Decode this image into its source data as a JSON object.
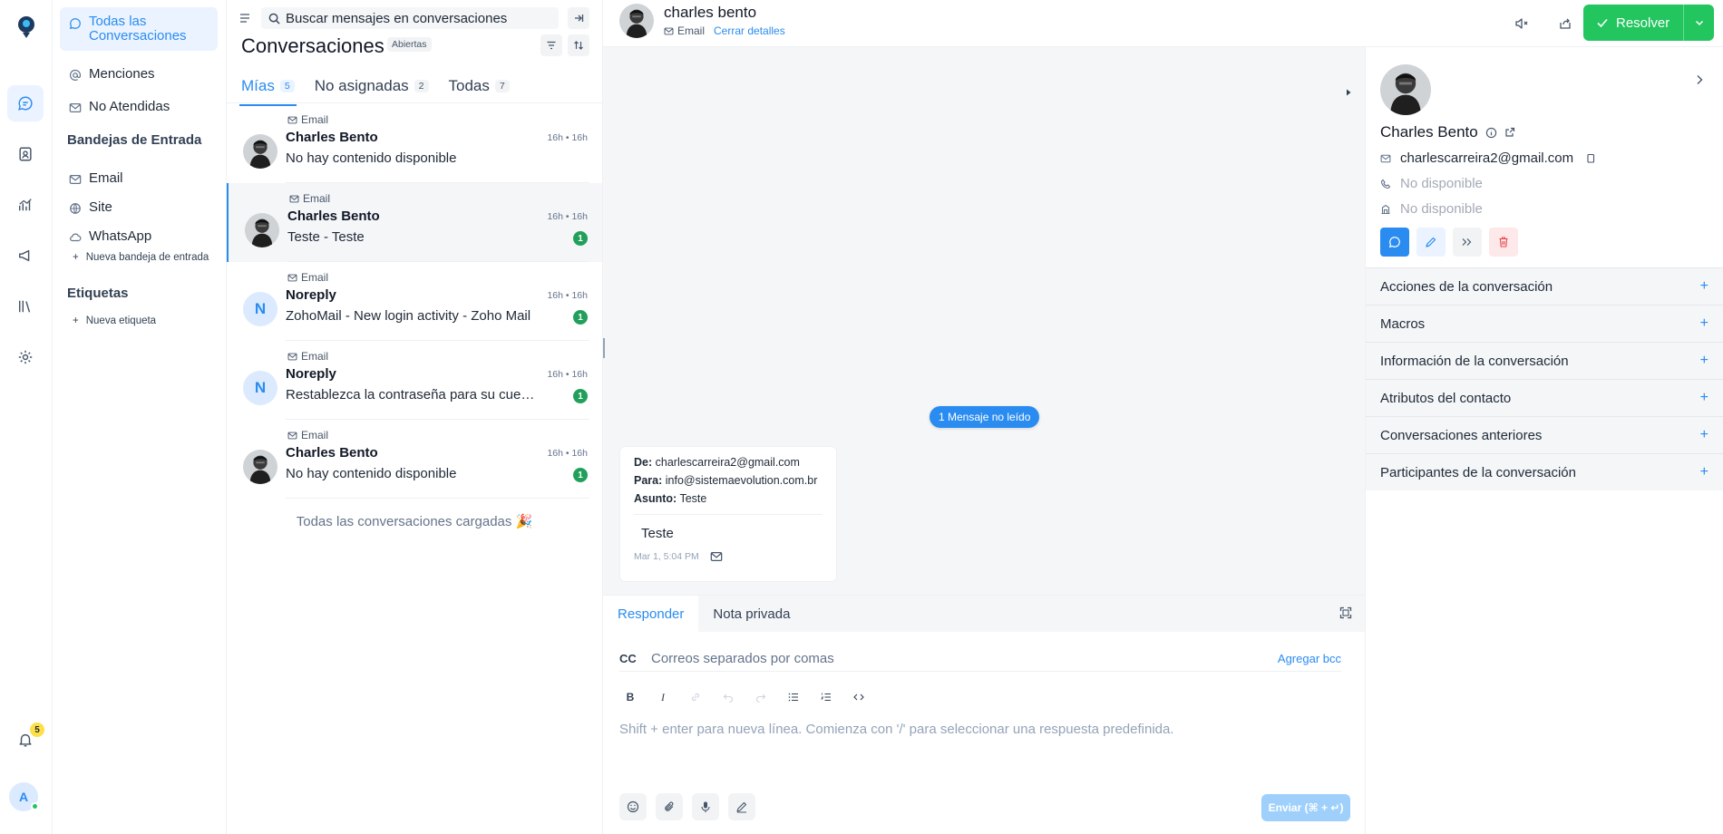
{
  "rail": {
    "notification_count": "5",
    "avatar_initial": "A"
  },
  "sidebar": {
    "items": [
      {
        "label": "Todas las Conversaciones"
      },
      {
        "label": "Menciones"
      },
      {
        "label": "No Atendidas"
      }
    ],
    "inboxes_title": "Bandejas de Entrada",
    "inboxes": [
      {
        "label": "Email"
      },
      {
        "label": "Site"
      },
      {
        "label": "WhatsApp"
      }
    ],
    "new_inbox": "Nueva bandeja de entrada",
    "labels_title": "Etiquetas",
    "new_label": "Nueva etiqueta"
  },
  "list": {
    "search_placeholder": "Buscar mensajes en conversaciones",
    "title": "Conversaciones",
    "status": "Abiertas",
    "tabs": [
      {
        "label": "Mías",
        "count": "5"
      },
      {
        "label": "No asignadas",
        "count": "2"
      },
      {
        "label": "Todas",
        "count": "7"
      }
    ],
    "conversations": [
      {
        "inbox": "Email",
        "name": "Charles Bento",
        "message": "No hay contenido disponible",
        "time": "16h • 16h",
        "unread": "",
        "avatar": "photo",
        "initial": ""
      },
      {
        "inbox": "Email",
        "name": "Charles Bento",
        "message": "Teste - Teste",
        "time": "16h • 16h",
        "unread": "1",
        "avatar": "photo",
        "initial": ""
      },
      {
        "inbox": "Email",
        "name": "Noreply",
        "message": "ZohoMail - New login activity - Zoho Mail",
        "time": "16h • 16h",
        "unread": "1",
        "avatar": "letter",
        "initial": "N"
      },
      {
        "inbox": "Email",
        "name": "Noreply",
        "message": "Restablezca la contraseña para su cuenta",
        "time": "16h • 16h",
        "unread": "1",
        "avatar": "letter",
        "initial": "N"
      },
      {
        "inbox": "Email",
        "name": "Charles Bento",
        "message": "No hay contenido disponible",
        "time": "16h • 16h",
        "unread": "1",
        "avatar": "photo",
        "initial": ""
      }
    ],
    "loaded_text": "Todas las conversaciones cargadas 🎉"
  },
  "chat": {
    "contact_name": "charles bento",
    "inbox": "Email",
    "close_details": "Cerrar detalles",
    "resolve_label": "Resolver",
    "unread_pill": "1 Mensaje no leído",
    "email": {
      "from_label": "De:",
      "from": "charlescarreira2@gmail.com",
      "to_label": "Para:",
      "to": "info@sistemaevolution.com.br",
      "subject_label": "Asunto:",
      "subject": "Teste",
      "body": "Teste",
      "time": "Mar 1, 5:04 PM"
    }
  },
  "reply": {
    "tab_reply": "Responder",
    "tab_note": "Nota privada",
    "cc_label": "CC",
    "cc_placeholder": "Correos separados por comas",
    "add_bcc": "Agregar bcc",
    "editor_placeholder": "Shift + enter para nueva línea. Comienza con '/' para seleccionar una respuesta predefinida.",
    "send_label": "Enviar (⌘ + ↵)"
  },
  "contact": {
    "name": "Charles Bento",
    "email": "charlescarreira2@gmail.com",
    "phone": "No disponible",
    "company": "No disponible",
    "sections": [
      "Acciones de la conversación",
      "Macros",
      "Información de la conversación",
      "Atributos del contacto",
      "Conversaciones anteriores",
      "Participantes de la conversación"
    ]
  },
  "colors": {
    "accent": "#2a8cf0",
    "resolve": "#22c55e",
    "unread_badge": "#22a05b"
  }
}
